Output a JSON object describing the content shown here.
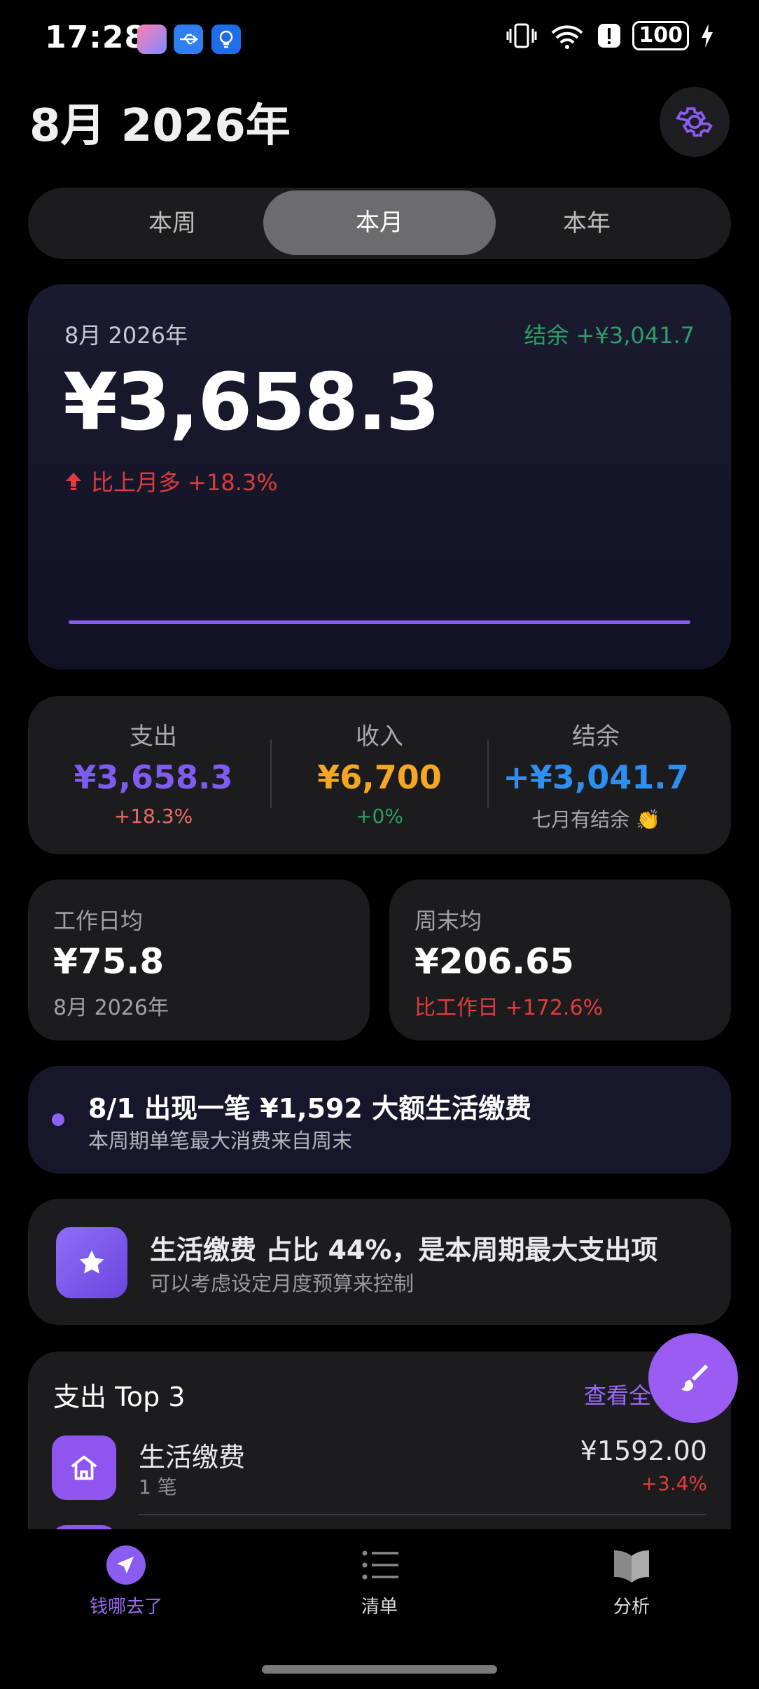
{
  "status_bar": {
    "time": "17:28",
    "battery": "100"
  },
  "header": {
    "title": "8月 2026年"
  },
  "segments": [
    "本周",
    "本月",
    "本年"
  ],
  "hero": {
    "period": "8月 2026年",
    "balance": "结余 +¥3,041.7",
    "amount": "¥3,658.3",
    "change": "比上月多 +18.3%"
  },
  "summary": {
    "expense": {
      "label": "支出",
      "value": "¥3,658.3",
      "sub": "+18.3%"
    },
    "income": {
      "label": "收入",
      "value": "¥6,700",
      "sub": "+0%"
    },
    "balance": {
      "label": "结余",
      "value": "+¥3,041.7",
      "sub": "七月有结余 👏"
    }
  },
  "weekday_card": {
    "label": "工作日均",
    "value": "¥75.8",
    "sub": "8月 2026年"
  },
  "weekend_card": {
    "label": "周末均",
    "value": "¥206.65",
    "sub": "比工作日 +172.6%"
  },
  "insight": {
    "title": "8/1 出现一笔 ¥1,592 大额生活缴费",
    "sub": "本周期单笔最大消费来自周末"
  },
  "tip": {
    "title": "生活缴费 占比 44%，是本周期最大支出项",
    "sub": "可以考虑设定月度预算来控制"
  },
  "top3": {
    "title": "支出 Top 3",
    "link": "查看全",
    "items": [
      {
        "name": "生活缴费",
        "count": "1 笔",
        "amount": "¥1592.00",
        "change": "+3.4%"
      }
    ]
  },
  "nav": [
    {
      "label": "钱哪去了",
      "icon": "navigation-icon",
      "active": true
    },
    {
      "label": "清单",
      "icon": "list-icon",
      "active": false
    },
    {
      "label": "分析",
      "icon": "book-icon",
      "active": false
    }
  ],
  "colors": {
    "accent": "#8a5cf0",
    "income": "#f5a623",
    "balance": "#2f8ff0",
    "up": "#e23b3b",
    "positive": "#2e9e66"
  }
}
